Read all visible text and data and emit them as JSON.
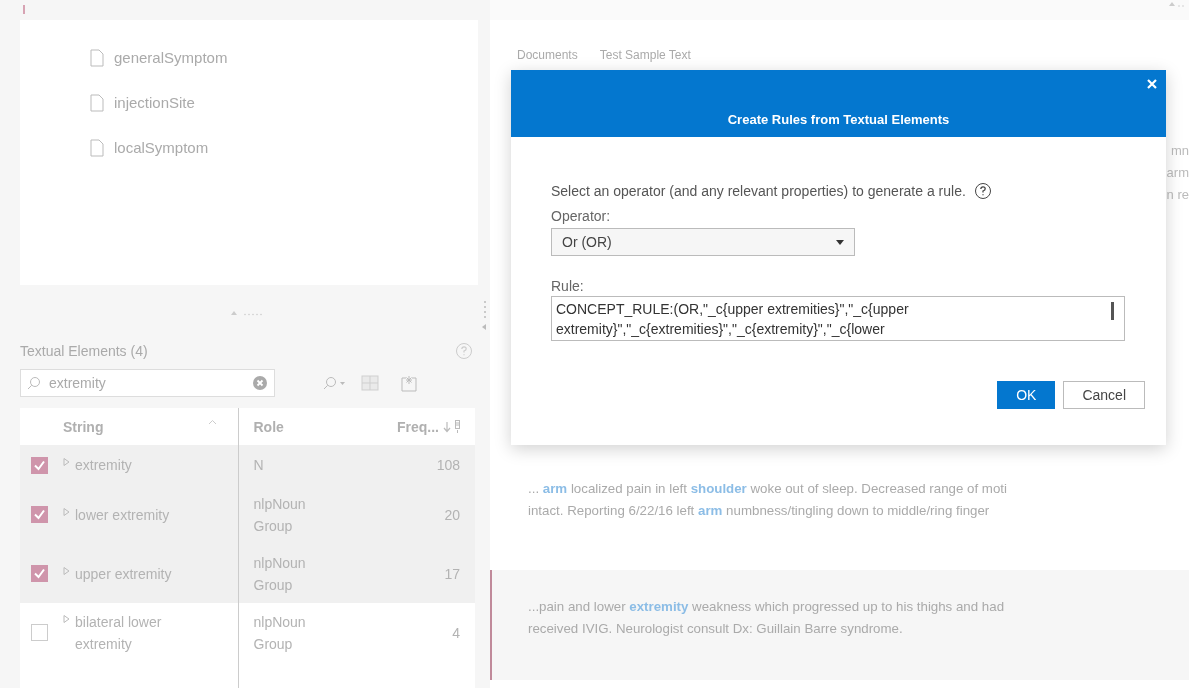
{
  "left_panel": {
    "tree_items": [
      {
        "label": "generalSymptom"
      },
      {
        "label": "injectionSite"
      },
      {
        "label": "localSymptom"
      }
    ],
    "textual_elements": {
      "title": "Textual Elements (4)",
      "search": {
        "value": "extremity"
      },
      "columns": [
        {
          "label": "String",
          "kind": "ascending",
          "menu": false
        },
        {
          "label": "Role",
          "kind": "plain",
          "menu": false
        },
        {
          "label": "Freq...",
          "kind": "descending",
          "menu": true
        }
      ],
      "rows": [
        {
          "checked": true,
          "string": "extremity",
          "role": "N",
          "freq": "108"
        },
        {
          "checked": true,
          "string": "lower extremity",
          "role": "nlpNoun Group",
          "freq": "20"
        },
        {
          "checked": true,
          "string": "upper extremity",
          "role": "nlpNoun Group",
          "freq": "17"
        },
        {
          "checked": false,
          "string": "bilateral lower extremity",
          "role": "nlpNoun Group",
          "freq": "4"
        }
      ]
    }
  },
  "right_panel": {
    "tabs": [
      {
        "label": "Documents"
      },
      {
        "label": "Test Sample Text"
      }
    ],
    "covered_fragments": [
      "mn",
      "arm",
      "n re"
    ],
    "snippets": [
      {
        "selected": false,
        "lines": [
          "... **arm** localized pain in left **shoulder** woke out of sleep. Decreased range of moti",
          "intact. Reporting 6/22/16 left **arm** numbness/tingling down to middle/ring finger"
        ]
      },
      {
        "selected": true,
        "lines": [
          "...pain and lower **extremity** weakness which progressed up to his thighs and had",
          "received IVIG. Neurologist consult Dx: Guillain Barre syndrome."
        ]
      }
    ]
  },
  "dialog": {
    "title": "Create Rules from Textual Elements",
    "description": "Select an operator (and any relevant properties) to generate a rule.",
    "operator_label": "Operator:",
    "operator_value": "Or (OR)",
    "rule_label": "Rule:",
    "rule_value": "CONCEPT_RULE:(OR,\"_c{upper extremities}\",\"_c{upper extremity}\",\"_c{extremities}\",\"_c{extremity}\",\"_c{lower",
    "buttons": [
      {
        "label": "OK",
        "kind": "primary"
      },
      {
        "label": "Cancel",
        "kind": "secondary"
      }
    ]
  }
}
